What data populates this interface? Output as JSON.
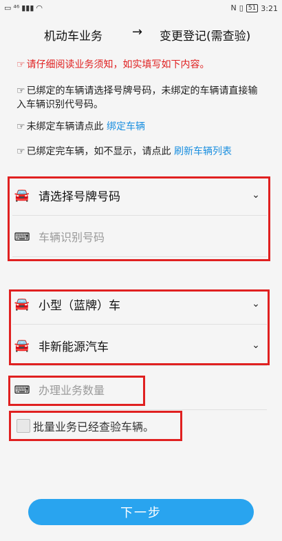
{
  "statusbar": {
    "left_icons": [
      "▭",
      "⁴⁶",
      "▮▮▮",
      "◠"
    ],
    "right_icons": [
      "N",
      "▯"
    ],
    "battery": "51",
    "time": "3:21"
  },
  "header": {
    "left": "机动车业务",
    "arrow": "→",
    "right": "变更登记(需查验)"
  },
  "notices": {
    "hand": "☞",
    "read_notice": "请仔细阅读业务须知，如实填写如下内容。",
    "bound_notice": "已绑定的车辆请选择号牌号码，未绑定的车辆请直接输入车辆识别代号码。",
    "unbound_text": "未绑定车辆请点此",
    "unbound_link": "绑定车辆",
    "refresh_text": "已绑定完车辆，如不显示，请点此",
    "refresh_link": "刷新车辆列表"
  },
  "form": {
    "plate_select": "请选择号牌号码",
    "vin_placeholder": "车辆识别号码",
    "vehicle_type": "小型（蓝牌）车",
    "energy_type": "非新能源汽车",
    "quantity_placeholder": "办理业务数量",
    "batch_checkbox_label": "批量业务已经查验车辆。"
  },
  "icons": {
    "car": "car-icon",
    "keyboard": "keyboard-icon",
    "chevron": "chevron-down-icon"
  },
  "colors": {
    "accent": "#29a4ef",
    "highlight": "#e02020",
    "link": "#1a8fe0"
  },
  "buttons": {
    "next": "下一步"
  }
}
